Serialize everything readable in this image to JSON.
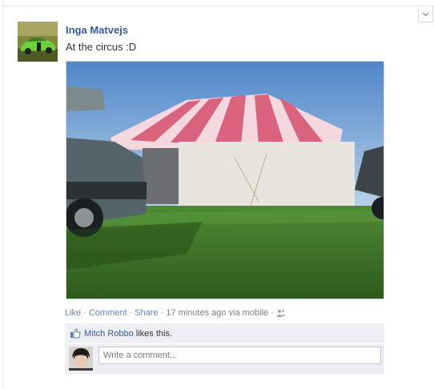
{
  "post": {
    "author": "Inga Matvejs",
    "status": "At the circus :D",
    "actions": {
      "like": "Like",
      "comment": "Comment",
      "share": "Share",
      "meta": "17 minutes ago via mobile"
    },
    "likes": {
      "name": "Mitch Robbo",
      "text": "likes this."
    },
    "comment_input": {
      "placeholder": "Write a comment..."
    }
  },
  "icons": {
    "options": "chevron-down-icon",
    "privacy": "friends-icon",
    "like": "thumbs-up-icon"
  },
  "colors": {
    "link": "#3b5998",
    "action_link": "#6d84b4",
    "ufi_background": "#edeff4"
  }
}
